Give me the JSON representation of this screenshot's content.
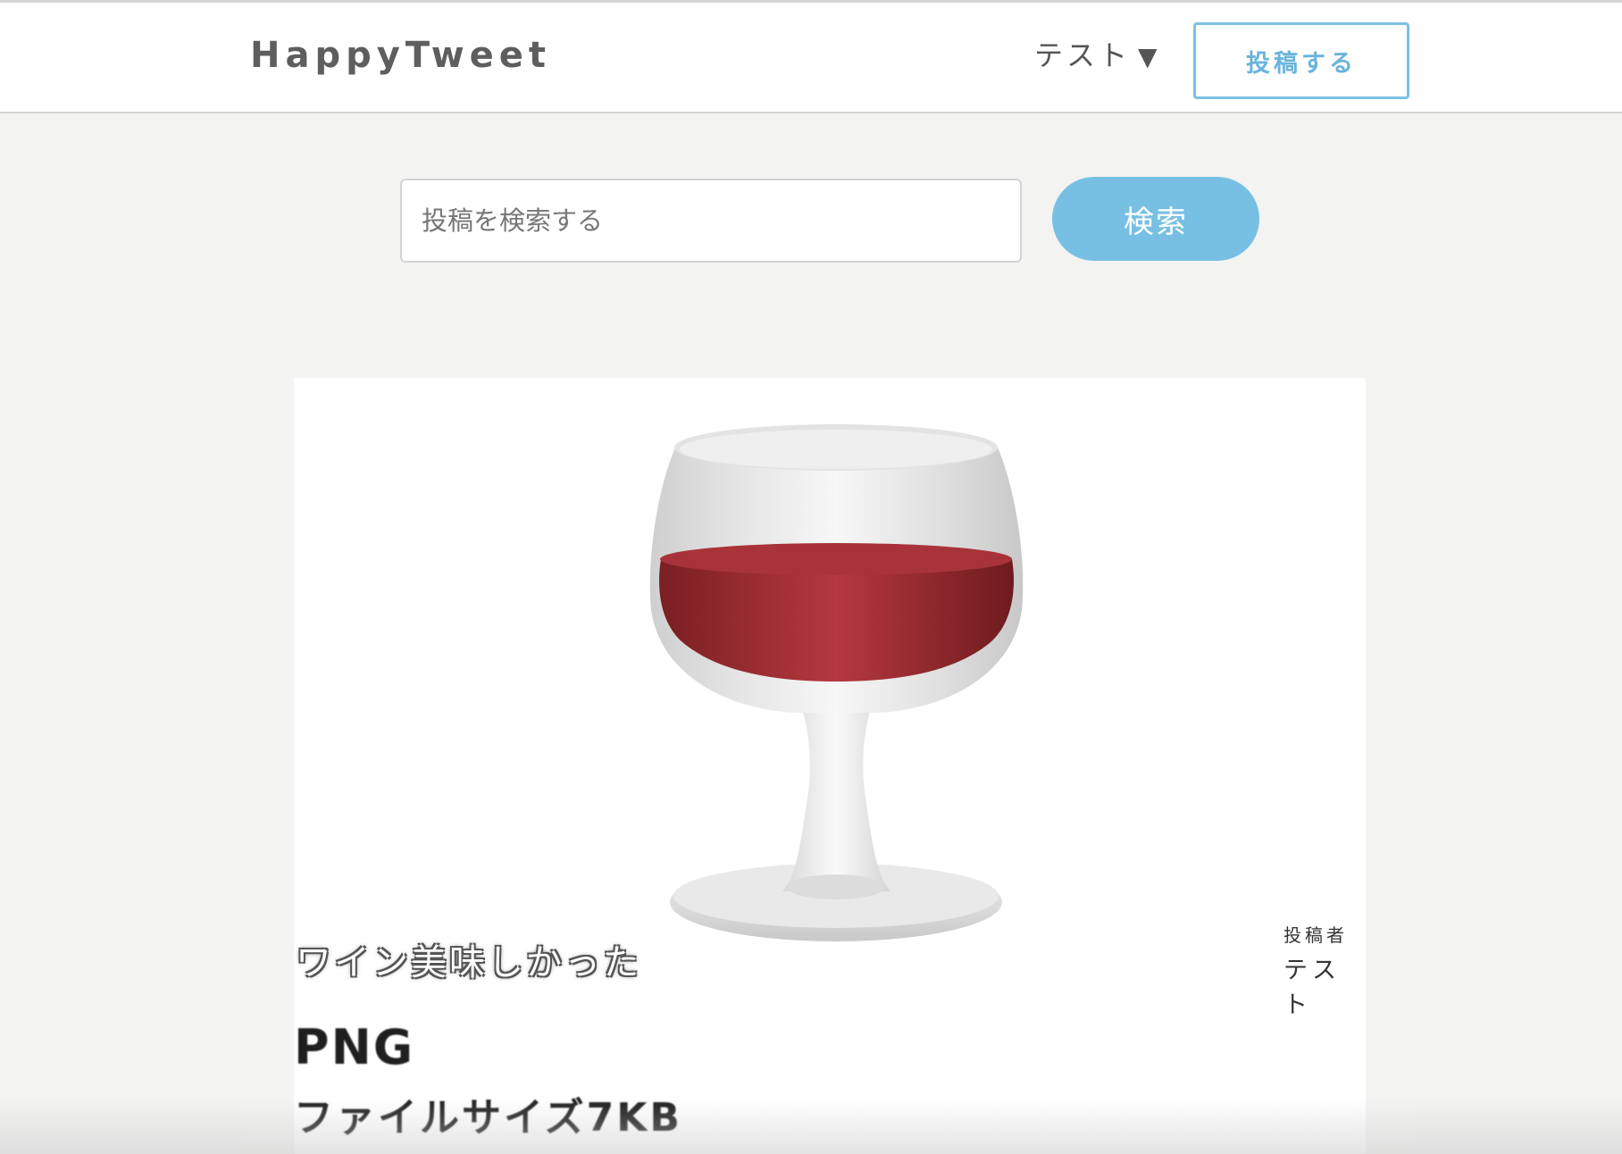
{
  "header": {
    "logo": "HappyTweet",
    "user_name": "テスト",
    "user_caret": "▼",
    "post_button_label": "投稿する"
  },
  "search": {
    "placeholder": "投稿を検索する",
    "button_label": "検索"
  },
  "post": {
    "image_caption": "ワイン美味しかった",
    "image_text_format": "PNG",
    "image_text_filesize": "ファイルサイズ7KB",
    "author_label": "投稿者",
    "author_name": "テスト"
  },
  "colors": {
    "accent": "#77c0e4",
    "wine": "#a8333a"
  }
}
